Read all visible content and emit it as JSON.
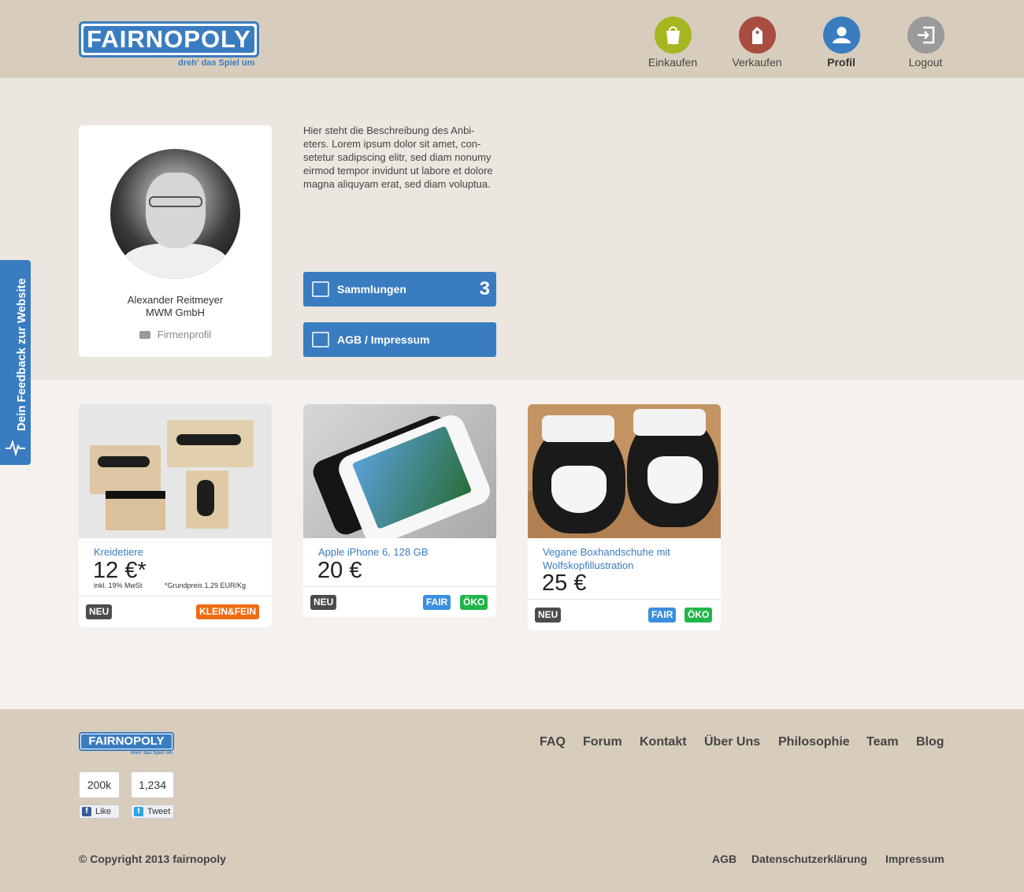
{
  "brand": {
    "name": "FAIRNOPOLY",
    "tagline": "dreh' das Spiel um"
  },
  "nav": [
    {
      "label": "Einkaufen",
      "icon": "shopping-bag-icon",
      "color": "#a5b620",
      "active": false
    },
    {
      "label": "Verkaufen",
      "icon": "price-tag-icon",
      "color": "#a84d3f",
      "active": false
    },
    {
      "label": "Profil",
      "icon": "user-icon",
      "color": "#3a7cc0",
      "active": true
    },
    {
      "label": "Logout",
      "icon": "logout-icon",
      "color": "#9a9a9a",
      "active": false
    }
  ],
  "profile": {
    "name": "Alexander Reitmeyer",
    "company": "MWM GmbH",
    "profile_type": "Firmenprofil",
    "description": "Hier steht die Beschreibung des Anbi-eters. Lorem ipsum dolor sit amet, con-setetur sadipscing elitr, sed diam nonumy eirmod tempor invidunt ut labore et dolore magna aliquyam erat, sed diam voluptua.",
    "collections_label": "Sammlungen",
    "collections_count": "3",
    "agb_label": "AGB / Impressum"
  },
  "products": [
    {
      "title": "Kreidetiere",
      "price": "12 €*",
      "vat_note": "inkl. 19% MwSt",
      "base_price": "*Grundpreis 1,29 EUR/Kg",
      "badges": [
        "NEU",
        "KLEIN&FEIN"
      ]
    },
    {
      "title": "Apple iPhone 6, 128 GB",
      "price": "20 €",
      "badges": [
        "NEU",
        "FAIR",
        "ÖKO"
      ]
    },
    {
      "title": "Vegane Boxhandschuhe mit Wolfskopfillustration",
      "price": "25 €",
      "badges": [
        "NEU",
        "FAIR",
        "ÖKO"
      ]
    }
  ],
  "footer": {
    "nav": [
      "FAQ",
      "Forum",
      "Kontakt",
      "Über Uns",
      "Philosophie",
      "Team",
      "Blog"
    ],
    "facebook": {
      "count": "200k",
      "label": "Like"
    },
    "twitter": {
      "count": "1,234",
      "label": "Tweet"
    },
    "copyright": "© Copyright 2013 fairnopoly",
    "legal": [
      "AGB",
      "Datenschutzerklärung",
      "Impressum"
    ]
  },
  "feedback": {
    "label": "Dein Feedback zur Website"
  }
}
